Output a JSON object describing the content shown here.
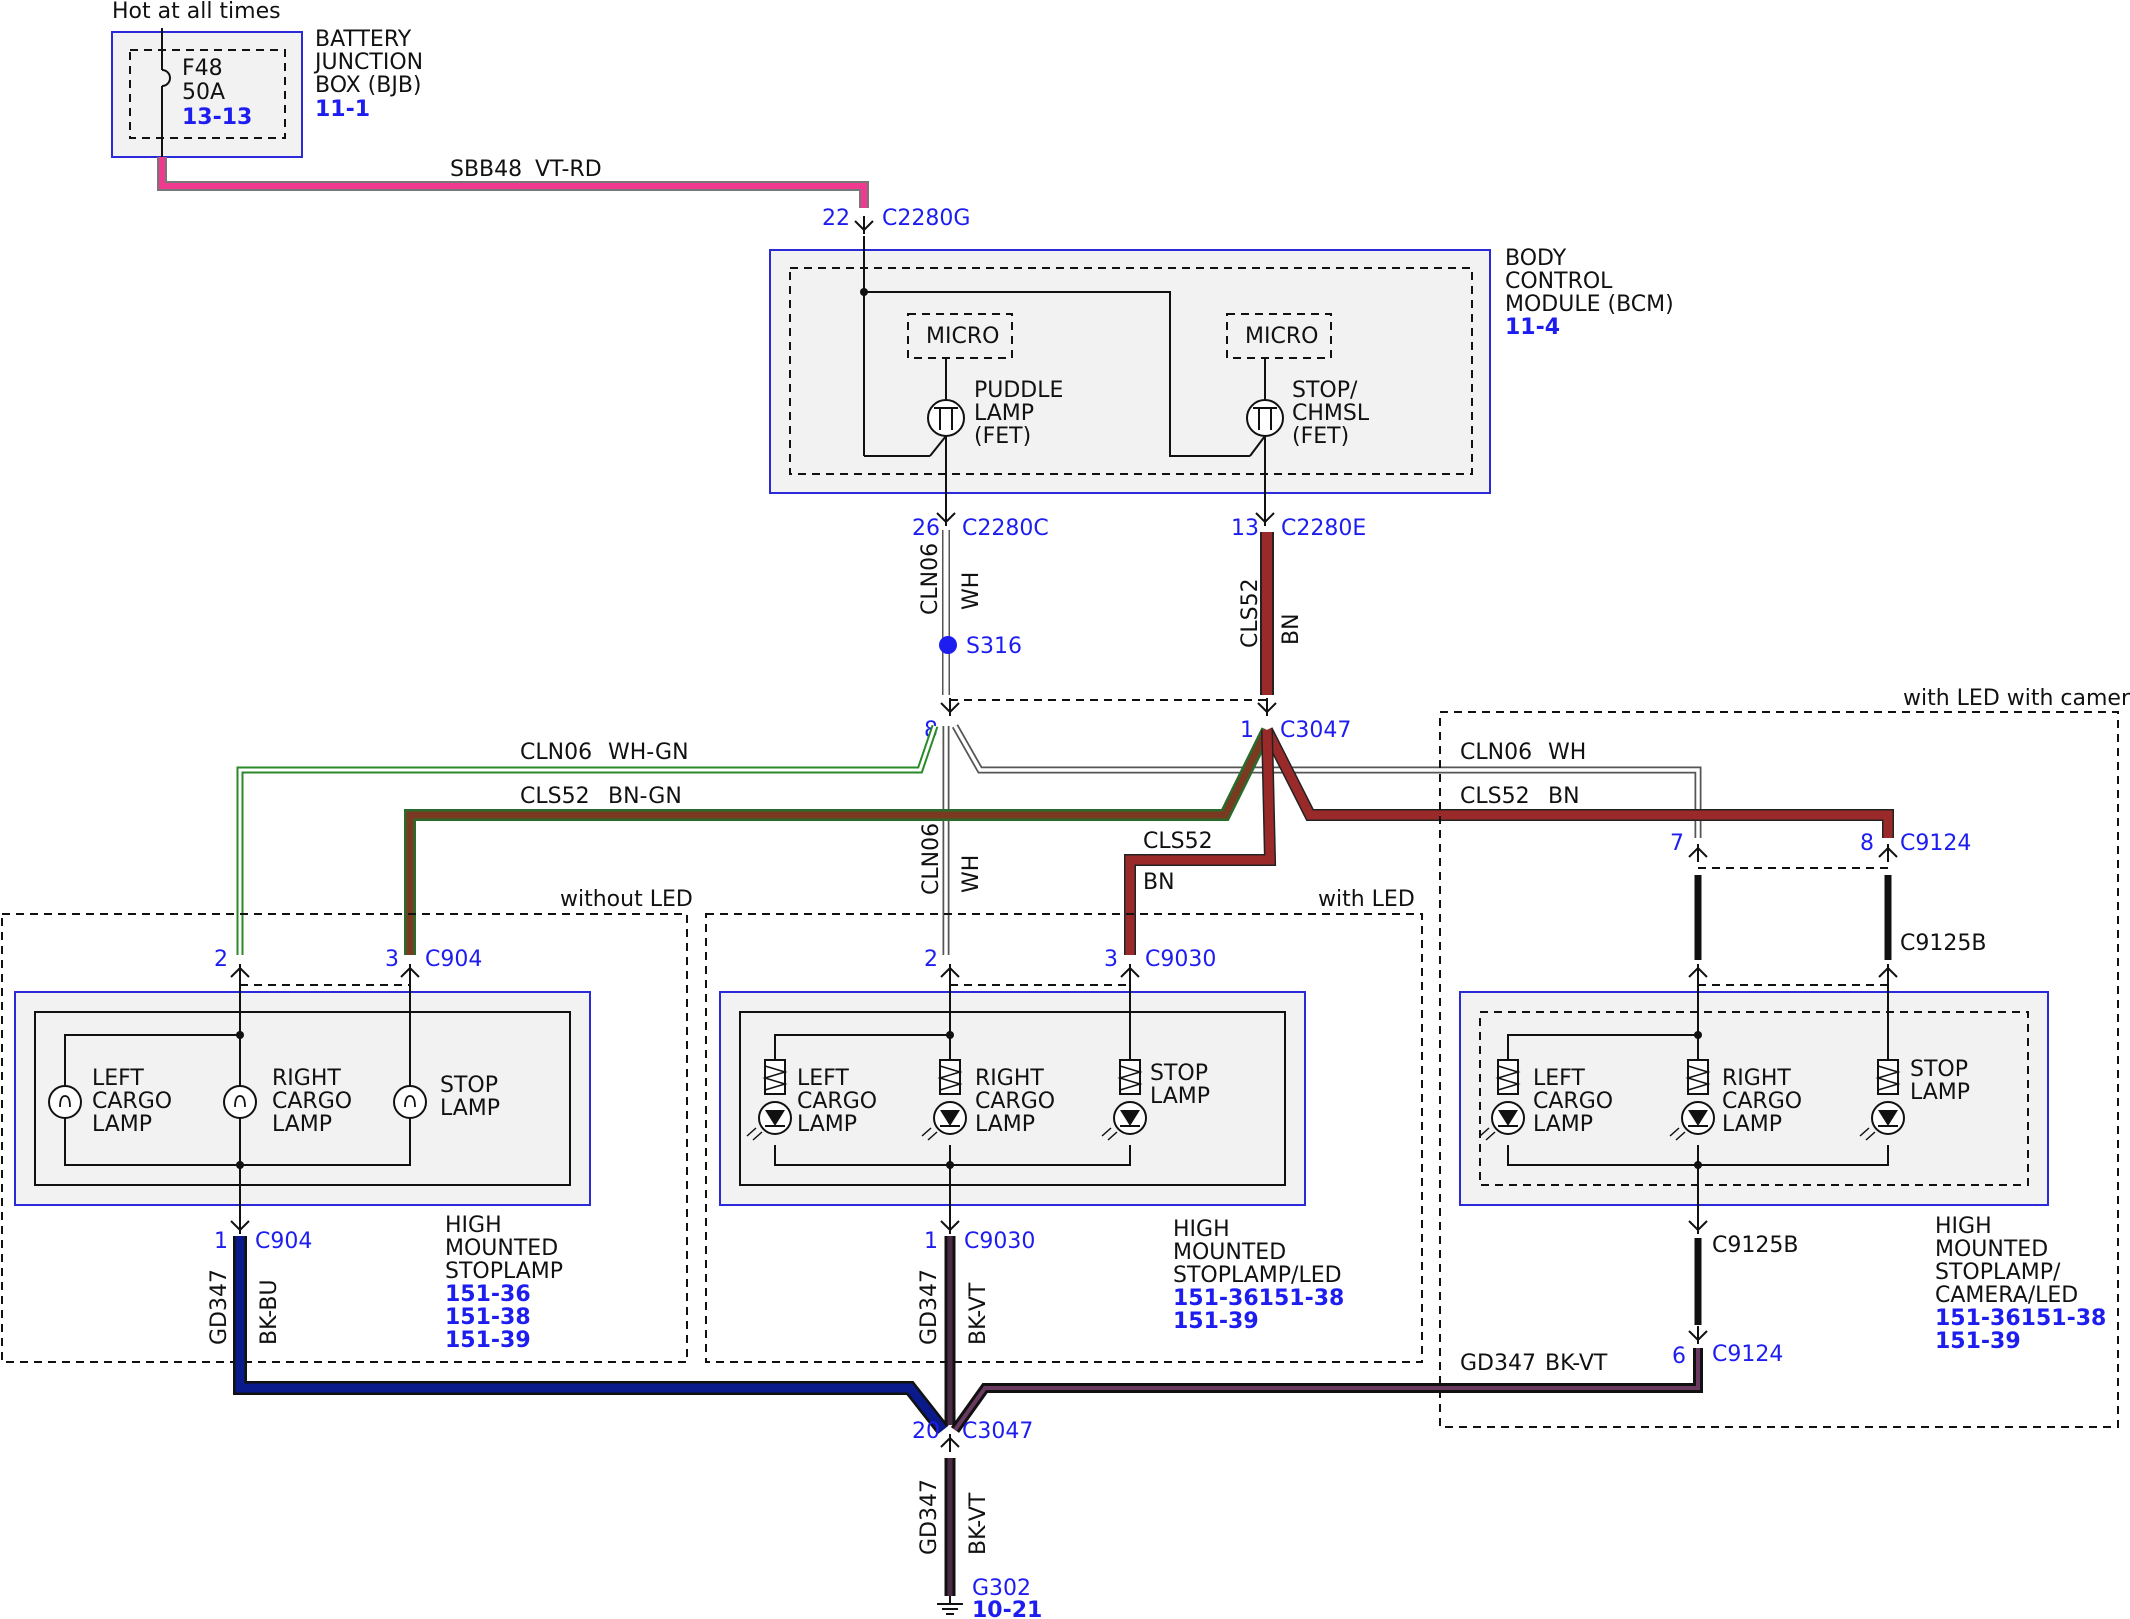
{
  "colors": {
    "vt_rd": "#ef3a8f",
    "bn": "#9a2a2a",
    "bk_bu": "#0a1a8a",
    "bk_vt": "#4a2a45",
    "wh_gn": "#2a8a2a",
    "bn_gn": "#6a3a22",
    "ref_blue": "#1d1df0"
  },
  "bjb": {
    "caption": "Hot at all times",
    "name_lines": [
      "BATTERY",
      "JUNCTION",
      "BOX (BJB)"
    ],
    "ref": "11-1",
    "fuse_name": "F48",
    "fuse_rating": "50A",
    "fuse_ref": "13-13"
  },
  "wire_sbb48": {
    "circuit": "SBB48",
    "color": "VT-RD"
  },
  "bcm": {
    "name_lines": [
      "BODY",
      "CONTROL",
      "MODULE (BCM)"
    ],
    "ref": "11-4",
    "micro_label": "MICRO",
    "puddle_lines": [
      "PUDDLE",
      "LAMP",
      "(FET)"
    ],
    "stop_lines": [
      "STOP/",
      "CHMSL",
      "(FET)"
    ]
  },
  "connectors": {
    "c2280g": {
      "pin": "22",
      "name": "C2280G"
    },
    "c2280c": {
      "pin": "26",
      "name": "C2280C"
    },
    "c2280e": {
      "pin": "13",
      "name": "C2280E"
    },
    "c3047_top_wh": {
      "pin": "8"
    },
    "c3047_top_bn": {
      "pin": "1",
      "name": "C3047"
    },
    "c904_top_2": {
      "pin": "2"
    },
    "c904_top_3": {
      "pin": "3",
      "name": "C904"
    },
    "c904_bot": {
      "pin": "1",
      "name": "C904"
    },
    "c9030_top_2": {
      "pin": "2"
    },
    "c9030_top_3": {
      "pin": "3",
      "name": "C9030"
    },
    "c9030_bot": {
      "pin": "1",
      "name": "C9030"
    },
    "c9124_top_7": {
      "pin": "7"
    },
    "c9124_top_8": {
      "pin": "8",
      "name": "C9124"
    },
    "c9125b_top": {
      "name": "C9125B"
    },
    "c9125b_bot": {
      "name": "C9125B"
    },
    "c9124_bot": {
      "pin": "6",
      "name": "C9124"
    },
    "c3047_bot": {
      "pin": "20",
      "name": "C3047"
    }
  },
  "splice": {
    "name": "S316"
  },
  "wires": {
    "cln06_wh": {
      "circuit": "CLN06",
      "color": "WH"
    },
    "cls52_bn": {
      "circuit": "CLS52",
      "color": "BN"
    },
    "cln06_whgn": {
      "circuit": "CLN06",
      "color": "WH-GN"
    },
    "cls52_bngn": {
      "circuit": "CLS52",
      "color": "BN-GN"
    },
    "cln06_wh_right": {
      "circuit": "CLN06",
      "color": "WH"
    },
    "cls52_bn_right": {
      "circuit": "CLS52",
      "color": "BN"
    },
    "cln06_wh_mid": {
      "circuit": "CLN06",
      "color": "WH"
    },
    "cls52_mid": {
      "circuit": "CLS52",
      "color": "BN"
    },
    "gd347_bkbu": {
      "circuit": "GD347",
      "color": "BK-BU"
    },
    "gd347_bkvt_mid": {
      "circuit": "GD347",
      "color": "BK-VT"
    },
    "gd347_bkvt_right": {
      "circuit": "GD347",
      "color": "BK-VT"
    },
    "gd347_bkvt_bot": {
      "circuit": "GD347",
      "color": "BK-VT"
    }
  },
  "variants": {
    "without_led": "without LED",
    "with_led": "with LED",
    "with_led_camera": "with LED with camera"
  },
  "lamps": {
    "left_lines": [
      "LEFT",
      "CARGO",
      "LAMP"
    ],
    "right_lines": [
      "RIGHT",
      "CARGO",
      "LAMP"
    ],
    "stop_lines": [
      "STOP",
      "LAMP"
    ]
  },
  "hms1": {
    "name_lines": [
      "HIGH",
      "MOUNTED",
      "STOPLAMP"
    ],
    "refs": [
      "151-36",
      "151-38",
      "151-39"
    ]
  },
  "hms2": {
    "name_lines": [
      "HIGH",
      "MOUNTED",
      "STOPLAMP/LED"
    ],
    "refs": [
      "151-36151-38",
      "151-39"
    ]
  },
  "hms3": {
    "name_lines": [
      "HIGH",
      "MOUNTED",
      "STOPLAMP/",
      "CAMERA/LED"
    ],
    "refs": [
      "151-36151-38",
      "151-39"
    ]
  },
  "ground": {
    "name": "G302",
    "ref": "10-21"
  }
}
